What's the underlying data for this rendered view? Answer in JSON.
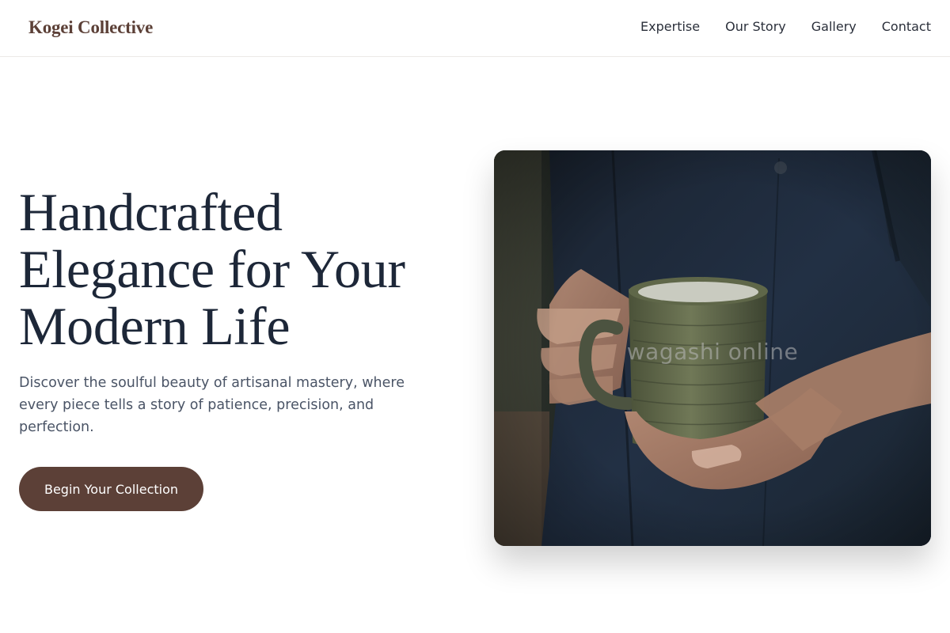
{
  "header": {
    "brand": "Kogei Collective",
    "nav": [
      {
        "label": "Expertise"
      },
      {
        "label": "Our Story"
      },
      {
        "label": "Gallery"
      },
      {
        "label": "Contact"
      }
    ]
  },
  "hero": {
    "title_lines": [
      "Handcrafted",
      "Elegance for Your",
      "Modern Life"
    ],
    "description": "Discover the soulful beauty of artisanal mastery, where every piece tells a story of patience, precision, and perfection.",
    "cta_label": "Begin Your Collection",
    "image": {
      "subject": "hands holding a glazed ceramic mug",
      "watermark": "wagashi online"
    }
  },
  "colors": {
    "brand": "#5c4037",
    "heading": "#1d2738",
    "body_text": "#4a5466",
    "nav_text": "#2a2f3a"
  }
}
